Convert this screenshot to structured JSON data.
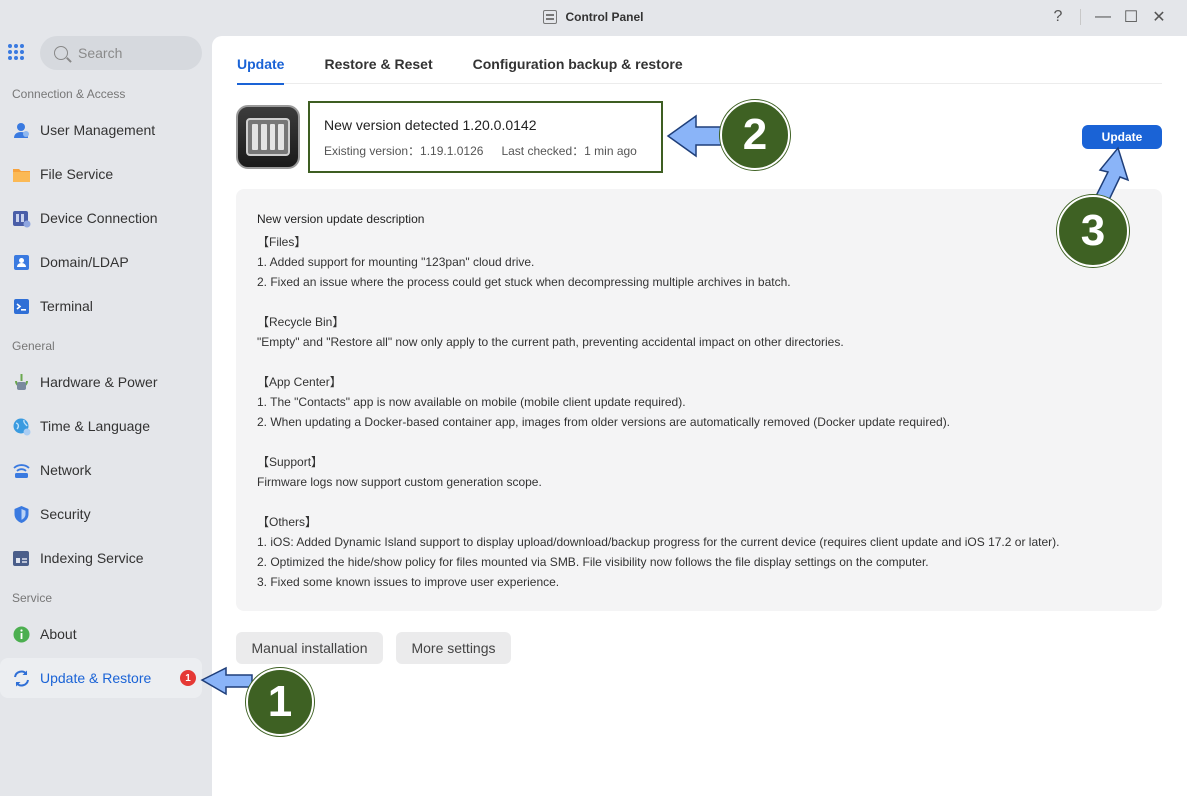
{
  "window": {
    "title": "Control Panel",
    "help_glyph": "?",
    "minimize_glyph": "—",
    "maximize_glyph": "☐",
    "close_glyph": "✕"
  },
  "sidebar": {
    "search_placeholder": "Search",
    "sections": [
      {
        "label": "Connection & Access"
      },
      {
        "label": "General"
      },
      {
        "label": "Service"
      }
    ],
    "items": [
      {
        "label": "User Management",
        "icon": "user-icon",
        "color": "#3a7ae0"
      },
      {
        "label": "File Service",
        "icon": "folder-icon",
        "color": "#f7a23b"
      },
      {
        "label": "Device Connection",
        "icon": "device-icon",
        "color": "#4a5ea8"
      },
      {
        "label": "Domain/LDAP",
        "icon": "domain-icon",
        "color": "#3a7ae0"
      },
      {
        "label": "Terminal",
        "icon": "terminal-icon",
        "color": "#2f6fd6"
      },
      {
        "label": "Hardware & Power",
        "icon": "hardware-icon",
        "color": "#6aa84f"
      },
      {
        "label": "Time & Language",
        "icon": "globe-icon",
        "color": "#3a9be0"
      },
      {
        "label": "Network",
        "icon": "network-icon",
        "color": "#3a7ae0"
      },
      {
        "label": "Security",
        "icon": "shield-icon",
        "color": "#3a7ae0"
      },
      {
        "label": "Indexing Service",
        "icon": "index-icon",
        "color": "#4a5e8a"
      },
      {
        "label": "About",
        "icon": "info-icon",
        "color": "#4caf50"
      },
      {
        "label": "Update & Restore",
        "icon": "update-icon",
        "color": "#2f6fd6",
        "badge": "1"
      }
    ]
  },
  "tabs": [
    {
      "label": "Update"
    },
    {
      "label": "Restore & Reset"
    },
    {
      "label": "Configuration backup & restore"
    }
  ],
  "version": {
    "title": "New version detected 1.20.0.0142",
    "existing": "Existing version：1.19.1.0126",
    "last_checked": "Last checked：1 min ago"
  },
  "update_button": "Update",
  "description": {
    "title": "New version update description",
    "groups": [
      {
        "heading": "【Files】",
        "lines": [
          "1. Added support for mounting \"123pan\" cloud drive.",
          "2. Fixed an issue where the process could get stuck when decompressing multiple archives in batch."
        ]
      },
      {
        "heading": "【Recycle Bin】",
        "lines": [
          "\"Empty\" and \"Restore all\" now only apply to the current path, preventing accidental impact on other directories."
        ]
      },
      {
        "heading": "【App Center】",
        "lines": [
          "1. The \"Contacts\" app is now available on mobile (mobile client update required).",
          "2. When updating a Docker-based container app, images from older versions are automatically removed (Docker update required)."
        ]
      },
      {
        "heading": "【Support】",
        "lines": [
          "Firmware logs now support custom generation scope."
        ]
      },
      {
        "heading": "【Others】",
        "lines": [
          "1. iOS: Added Dynamic Island support to display upload/download/backup progress for the current device (requires client update and iOS 17.2 or later).",
          "2. Optimized the hide/show policy for files mounted via SMB. File visibility now follows the file display settings on the computer.",
          "3. Fixed some known issues to improve user experience."
        ]
      }
    ]
  },
  "buttons": {
    "manual": "Manual installation",
    "more": "More settings"
  },
  "annotations": {
    "one": "1",
    "two": "2",
    "three": "3",
    "circle_color": "#3e6123",
    "arrow_color": "#8ab4f8"
  },
  "colors": {
    "accent": "#1a63d6",
    "badge": "#e53935"
  }
}
